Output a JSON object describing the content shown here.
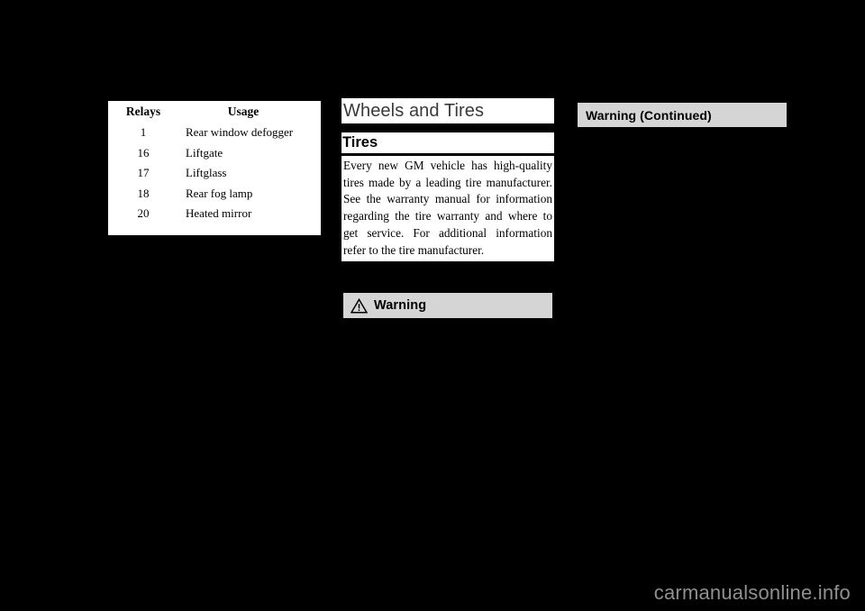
{
  "page": {
    "background_color": "#000000",
    "paper_color": "#ffffff"
  },
  "relay_table": {
    "headers": [
      "Relays",
      "Usage"
    ],
    "rows": [
      {
        "relay": "1",
        "usage": "Rear window defogger"
      },
      {
        "relay": "16",
        "usage": "Liftgate"
      },
      {
        "relay": "17",
        "usage": "Liftglass"
      },
      {
        "relay": "18",
        "usage": "Rear fog lamp"
      },
      {
        "relay": "20",
        "usage": "Heated mirror"
      }
    ]
  },
  "middle_column": {
    "chapter_title": "Wheels and Tires",
    "section_title": "Tires",
    "body_text": "Every new GM vehicle has high-quality tires made by a leading tire manufacturer. See the warranty manual for information regarding the tire warranty and where to get service. For additional information refer to the tire manufacturer.",
    "warning_box": {
      "label": "Warning",
      "icon": "warning-triangle-icon",
      "background_color": "#d5d5d5"
    }
  },
  "right_column": {
    "warning_continued_box": {
      "label": "Warning  (Continued)",
      "background_color": "#d5d5d5"
    }
  },
  "footer": {
    "watermark": "carmanualsonline.info",
    "color": "#909090"
  }
}
